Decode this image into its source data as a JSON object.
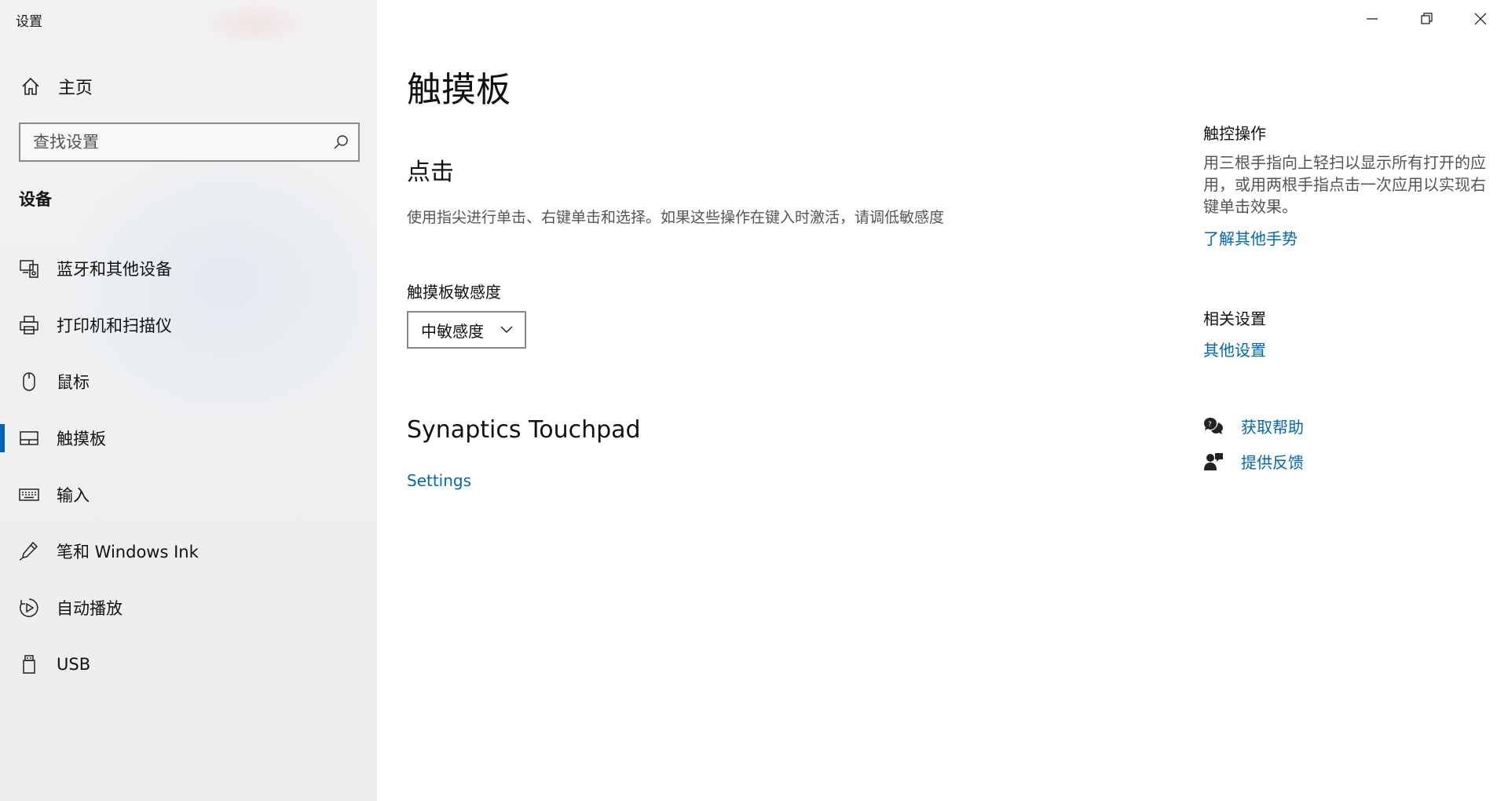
{
  "window": {
    "title": "设置"
  },
  "sidebar": {
    "home_label": "主页",
    "search_placeholder": "查找设置",
    "section_title": "设备",
    "items": [
      {
        "label": "蓝牙和其他设备",
        "icon": "bluetooth-devices-icon"
      },
      {
        "label": "打印机和扫描仪",
        "icon": "printer-icon"
      },
      {
        "label": "鼠标",
        "icon": "mouse-icon"
      },
      {
        "label": "触摸板",
        "icon": "touchpad-icon",
        "active": true
      },
      {
        "label": "输入",
        "icon": "keyboard-icon"
      },
      {
        "label": "笔和 Windows Ink",
        "icon": "pen-icon"
      },
      {
        "label": "自动播放",
        "icon": "autoplay-icon"
      },
      {
        "label": "USB",
        "icon": "usb-icon"
      }
    ]
  },
  "main": {
    "title": "触摸板",
    "click_heading": "点击",
    "click_description": "使用指尖进行单击、右键单击和选择。如果这些操作在键入时激活，请调低敏感度",
    "sensitivity_label": "触摸板敏感度",
    "sensitivity_value": "中敏感度",
    "synaptics_heading": "Synaptics Touchpad",
    "settings_link": "Settings"
  },
  "right": {
    "gestures_heading": "触控操作",
    "gestures_text": "用三根手指向上轻扫以显示所有打开的应用，或用两根手指点击一次应用以实现右键单击效果。",
    "gestures_link": "了解其他手势",
    "related_heading": "相关设置",
    "related_link": "其他设置",
    "help_link": "获取帮助",
    "feedback_link": "提供反馈"
  },
  "colors": {
    "accent": "#0063b1",
    "link": "#0067b8"
  }
}
